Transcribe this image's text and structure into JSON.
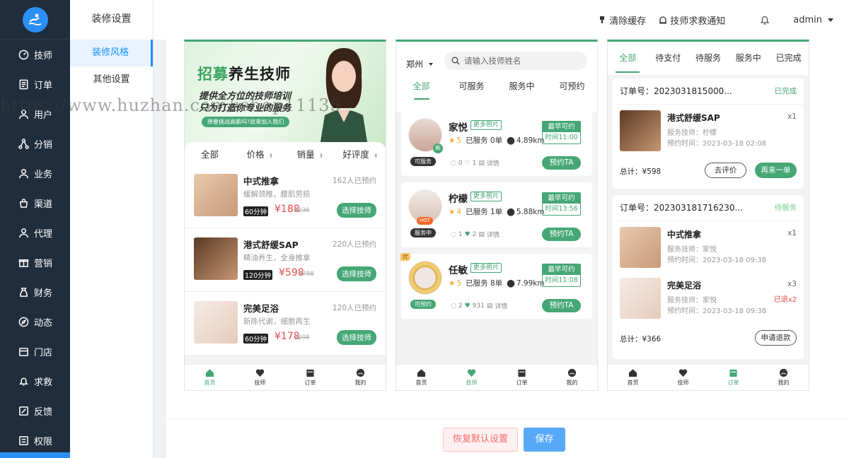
{
  "sidebar": {
    "items": [
      {
        "label": "技师",
        "icon": "gauge-icon"
      },
      {
        "label": "订单",
        "icon": "document-icon"
      },
      {
        "label": "用户",
        "icon": "user-icon"
      },
      {
        "label": "分销",
        "icon": "share-icon"
      },
      {
        "label": "业务",
        "icon": "user-icon"
      },
      {
        "label": "渠道",
        "icon": "bag-icon"
      },
      {
        "label": "代理",
        "icon": "user-icon"
      },
      {
        "label": "营销",
        "icon": "gift-icon"
      },
      {
        "label": "财务",
        "icon": "wallet-icon"
      },
      {
        "label": "动态",
        "icon": "compass-icon"
      },
      {
        "label": "门店",
        "icon": "store-icon"
      },
      {
        "label": "求救",
        "icon": "bell-icon"
      },
      {
        "label": "反馈",
        "icon": "edit-icon"
      },
      {
        "label": "权限",
        "icon": "list-icon"
      }
    ]
  },
  "subnav": {
    "title": "装修设置",
    "items": [
      {
        "label": "装修风格",
        "active": true
      },
      {
        "label": "其他设置",
        "active": false
      }
    ]
  },
  "header": {
    "clear_cache": "清除缓存",
    "sos_notice": "技师求救通知",
    "user": "admin"
  },
  "watermark": "https://www.huzhan.com/ishop11135",
  "phone1": {
    "banner": {
      "title_a": "招募",
      "title_b": "养生技师",
      "line1": "提供全方位的技师培训",
      "line2": "只为打造你专业的服务",
      "pill": "想要挑战高薪吗?就来加入我们"
    },
    "sort": [
      "全部",
      "价格",
      "销量",
      "好评度"
    ],
    "services": [
      {
        "name": "中式推拿",
        "booked": "162人已预约",
        "desc": "缓解颈椎，腰肌劳损",
        "duration": "60分钟",
        "price": "¥188",
        "old_price": "¥236",
        "button": "选择技师"
      },
      {
        "name": "港式舒缓SAP",
        "booked": "220人已预约",
        "desc": "精油养生，全身推拿",
        "duration": "120分钟",
        "price": "¥598",
        "old_price": "¥798",
        "button": "选择技师"
      },
      {
        "name": "完美足浴",
        "booked": "120人已预约",
        "desc": "新陈代谢，细胞再生",
        "duration": "60分钟",
        "price": "¥178",
        "old_price": "¥298",
        "button": "选择技师"
      }
    ]
  },
  "tabbar": [
    "首页",
    "技师",
    "订单",
    "我的"
  ],
  "phone2": {
    "city": "郑州",
    "search_placeholder": "请输入技师姓名",
    "tabs": [
      "全部",
      "可服务",
      "服务中",
      "可预约"
    ],
    "techs": [
      {
        "name": "家悦",
        "more": "更多照片",
        "score": "5",
        "served": "已服务 0单",
        "distance": "4.89km",
        "status": "可服务",
        "status_color": "#333333",
        "comments": "0",
        "likes": "1",
        "detail": "详情",
        "earliest": "最早可约",
        "time": "时间11:00",
        "book": "预约TA",
        "avatar_badge": "新"
      },
      {
        "name": "柠檬",
        "more": "更多照片",
        "score": "4",
        "served": "已服务 1单",
        "distance": "5.88km",
        "status": "服务中",
        "status_color": "#333333",
        "comments": "1",
        "likes": "2",
        "detail": "详情",
        "earliest": "最早可约",
        "time": "时间13:56",
        "book": "预约TA",
        "avatar_badge": "HOT"
      },
      {
        "name": "任敏",
        "more": "更多照片",
        "score": "5",
        "served": "已服务 8单",
        "distance": "7.99km",
        "status": "可预约",
        "status_color": "#45a775",
        "comments": "2",
        "likes": "931",
        "detail": "详情",
        "earliest": "最早可约",
        "time": "时间11:08",
        "book": "预约TA",
        "corner": "优"
      }
    ]
  },
  "phone3": {
    "tabs": [
      "全部",
      "待支付",
      "待服务",
      "服务中",
      "已完成"
    ],
    "orders": [
      {
        "no": "订单号：2023031815000...",
        "status": "已完成",
        "items": [
          {
            "name": "港式舒缓SAP",
            "qty": "x1",
            "tech": "服务技师：柠檬",
            "time": "预约时间：2023-03-18 02:08"
          }
        ],
        "total": "总计：¥598",
        "buttons": [
          "去评价",
          "再来一单"
        ]
      },
      {
        "no": "订单号：2023031817162​30...",
        "status": "待服务",
        "items": [
          {
            "name": "中式推拿",
            "qty": "x1",
            "tech": "服务技师：家悦",
            "time": "预约时间：2023-03-18 09:38"
          },
          {
            "name": "完美足浴",
            "qty": "x3",
            "tech": "服务技师：家悦",
            "time": "预约时间：2023-03-18 09:38",
            "refund": "已退x2"
          }
        ],
        "total": "总计：¥366",
        "buttons": [
          "申请退款"
        ]
      }
    ]
  },
  "footer": {
    "reset": "恢复默认设置",
    "save": "保存"
  },
  "colors": {
    "accent": "#45a775",
    "primary": "#1890ff",
    "danger": "#e84a4a",
    "sidebar": "#1f2d3d"
  }
}
